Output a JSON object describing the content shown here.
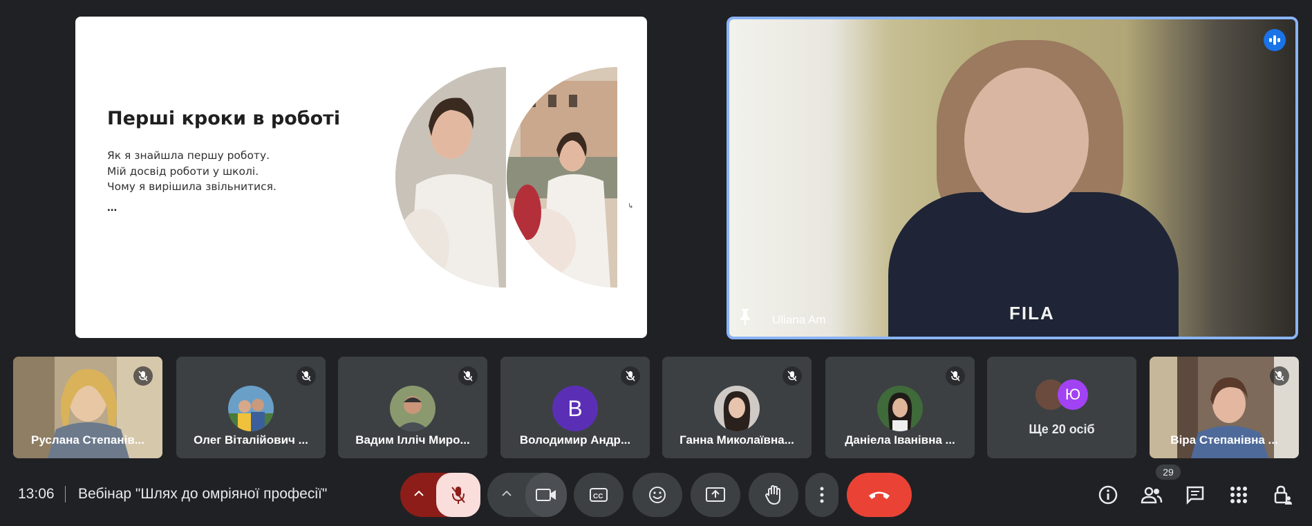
{
  "slide": {
    "title": "Перші кроки в роботі",
    "lines": [
      "Як я знайшла першу роботу.",
      "Мій досвід роботи у школі.",
      "Чому я вирішила звільнитися."
    ],
    "ellipsis": "..."
  },
  "speaker": {
    "name": "Uliana Am",
    "shirt_text": "FILA",
    "icons": [
      "speaking-indicator-icon",
      "pin-icon"
    ]
  },
  "participants": [
    {
      "name": "Руслана Степанів...",
      "avatar": "video",
      "muted": true
    },
    {
      "name": "Олег Віталійович ...",
      "avatar": "photo",
      "muted": true
    },
    {
      "name": "Вадим Ілліч Миро...",
      "avatar": "photo",
      "muted": true
    },
    {
      "name": "Володимир Андр...",
      "avatar": "letter",
      "initial": "B",
      "muted": true
    },
    {
      "name": "Ганна Миколаївна...",
      "avatar": "photo",
      "muted": true
    },
    {
      "name": "Даніела Іванівна ...",
      "avatar": "photo",
      "muted": true
    },
    {
      "name": "Віра Степанівна ...",
      "avatar": "video",
      "muted": true
    }
  ],
  "more_tile": {
    "label": "Ще 20 осіб",
    "initial": "Ю"
  },
  "bottom": {
    "time": "13:06",
    "meeting_title": "Вебінар \"Шлях до омріяної професії\"",
    "participant_count": "29"
  },
  "colors": {
    "background": "#202124",
    "tile": "#3c4043",
    "leave": "#ea4335",
    "speaker_border": "#8ab4f8",
    "mic_off": "#f9dedc"
  }
}
